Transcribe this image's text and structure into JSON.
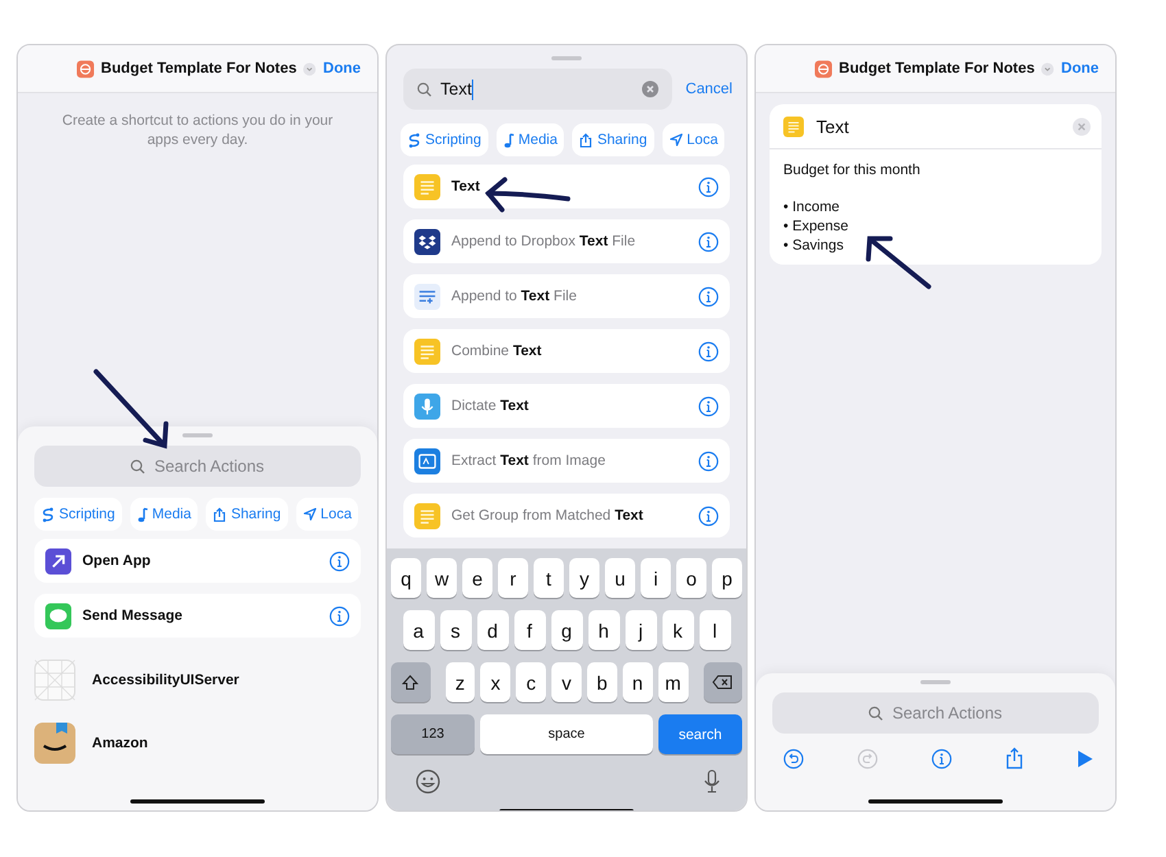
{
  "left_screen": {
    "header": {
      "title": "Budget Template For Notes",
      "done": "Done"
    },
    "hint": "Create a shortcut to actions you do in your apps every day.",
    "search": {
      "placeholder": "Search Actions"
    },
    "categories": [
      {
        "label": "Scripting",
        "kind": "scripting"
      },
      {
        "label": "Media",
        "kind": "media"
      },
      {
        "label": "Sharing",
        "kind": "sharing"
      },
      {
        "label": "Loca",
        "kind": "location"
      }
    ],
    "actions": [
      {
        "label": "Open App",
        "kind": "open-app"
      },
      {
        "label": "Send Message",
        "kind": "message"
      }
    ],
    "apps": [
      {
        "label": "AccessibilityUIServer",
        "kind": "grid"
      },
      {
        "label": "Amazon",
        "kind": "amazon"
      }
    ]
  },
  "middle_screen": {
    "search": {
      "value": "Text"
    },
    "cancel": "Cancel",
    "categories": [
      {
        "label": "Scripting",
        "kind": "scripting"
      },
      {
        "label": "Media",
        "kind": "media"
      },
      {
        "label": "Sharing",
        "kind": "sharing"
      },
      {
        "label": "Loca",
        "kind": "location"
      }
    ],
    "results": [
      {
        "label": "**Text**",
        "kind": "text"
      },
      {
        "label": "Append to Dropbox **Text** File",
        "kind": "dropbox"
      },
      {
        "label": "Append to **Text** File",
        "kind": "append-file"
      },
      {
        "label": "Combine **Text**",
        "kind": "text"
      },
      {
        "label": "Dictate **Text**",
        "kind": "dictate"
      },
      {
        "label": "Extract **Text** from Image",
        "kind": "extract"
      },
      {
        "label": "Get Group from Matched **Text**",
        "kind": "text"
      }
    ],
    "keyboard": {
      "rows": [
        [
          "q",
          "w",
          "e",
          "r",
          "t",
          "y",
          "u",
          "i",
          "o",
          "p"
        ],
        [
          "a",
          "s",
          "d",
          "f",
          "g",
          "h",
          "j",
          "k",
          "l"
        ],
        [
          "z",
          "x",
          "c",
          "v",
          "b",
          "n",
          "m"
        ]
      ],
      "numbers": "123",
      "space": "space",
      "search": "search"
    }
  },
  "right_screen": {
    "header": {
      "title": "Budget Template For Notes",
      "done": "Done"
    },
    "card": {
      "title": "Text",
      "heading": "Budget for this month",
      "bullets": [
        "• Income",
        "• Expense",
        "• Savings"
      ]
    },
    "search": {
      "placeholder": "Search Actions"
    },
    "toolbar": [
      {
        "kind": "undo",
        "disabled": false
      },
      {
        "kind": "redo",
        "disabled": true
      },
      {
        "kind": "info",
        "disabled": false
      },
      {
        "kind": "share",
        "disabled": false
      },
      {
        "kind": "run",
        "disabled": false
      }
    ]
  }
}
